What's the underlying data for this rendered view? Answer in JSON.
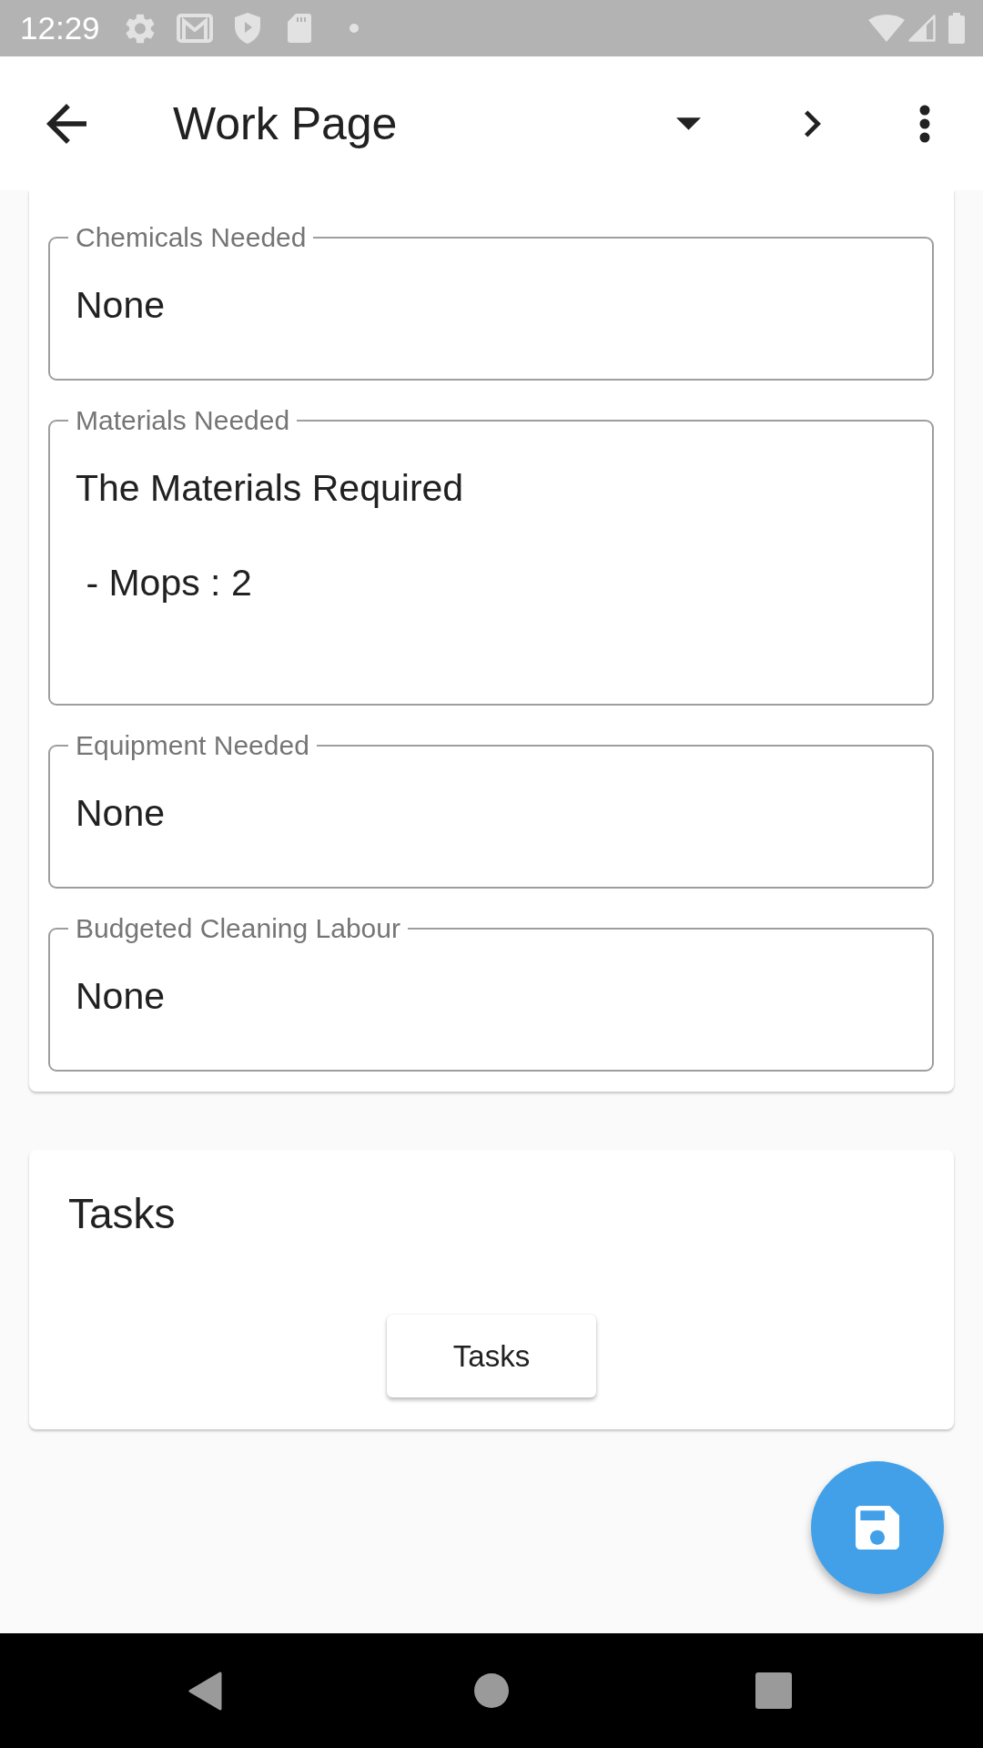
{
  "status_bar": {
    "time": "12:29"
  },
  "app_bar": {
    "title": "Work Page"
  },
  "details_card": {
    "fields": [
      {
        "label": "Chemicals Needed",
        "value": "None"
      },
      {
        "label": "Materials Needed",
        "value": "The Materials Required\n\n - Mops : 2"
      },
      {
        "label": "Equipment Needed",
        "value": "None"
      },
      {
        "label": "Budgeted Cleaning Labour",
        "value": "None"
      }
    ]
  },
  "tasks_card": {
    "title": "Tasks",
    "button": "Tasks"
  }
}
